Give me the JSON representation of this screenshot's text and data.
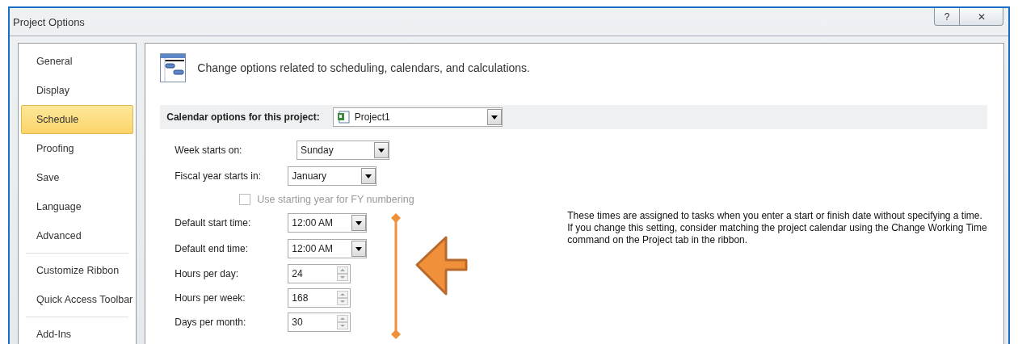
{
  "window": {
    "title": "Project Options",
    "buttons": [
      {
        "kind": "help",
        "label": "?"
      },
      {
        "kind": "close",
        "label": "✕"
      }
    ]
  },
  "sidebar": {
    "groups": [
      [
        {
          "label": "General",
          "selected": false
        },
        {
          "label": "Display",
          "selected": false
        },
        {
          "label": "Schedule",
          "selected": true
        },
        {
          "label": "Proofing",
          "selected": false
        },
        {
          "label": "Save",
          "selected": false
        },
        {
          "label": "Language",
          "selected": false
        },
        {
          "label": "Advanced",
          "selected": false
        }
      ],
      [
        {
          "label": "Customize Ribbon",
          "selected": false
        },
        {
          "label": "Quick Access Toolbar",
          "selected": false
        }
      ],
      [
        {
          "label": "Add-Ins",
          "selected": false
        }
      ]
    ]
  },
  "header": {
    "text": "Change options related to scheduling, calendars, and calculations."
  },
  "calendar_options": {
    "label": "Calendar options for this project:",
    "value": "Project1"
  },
  "fields": [
    {
      "kind": "dropdown",
      "label": "Week starts on:",
      "value": "Sunday"
    },
    {
      "kind": "dropdown",
      "label": "Fiscal year starts in:",
      "value": "January"
    },
    {
      "kind": "checkbox",
      "label": "Use starting year for FY numbering",
      "checked": false,
      "disabled": true
    },
    {
      "kind": "dropdown",
      "label": "Default start time:",
      "value": "12:00 AM"
    },
    {
      "kind": "dropdown",
      "label": "Default end time:",
      "value": "12:00 AM"
    },
    {
      "kind": "spinner",
      "label": "Hours per day:",
      "value": "24"
    },
    {
      "kind": "spinner",
      "label": "Hours per week:",
      "value": "168"
    },
    {
      "kind": "spinner",
      "label": "Days per month:",
      "value": "30"
    }
  ],
  "note": "These times are assigned to tasks when you enter a start or finish date without specifying a time. If you change this setting, consider matching the project calendar using the Change Working Time command on the Project tab in the ribbon."
}
